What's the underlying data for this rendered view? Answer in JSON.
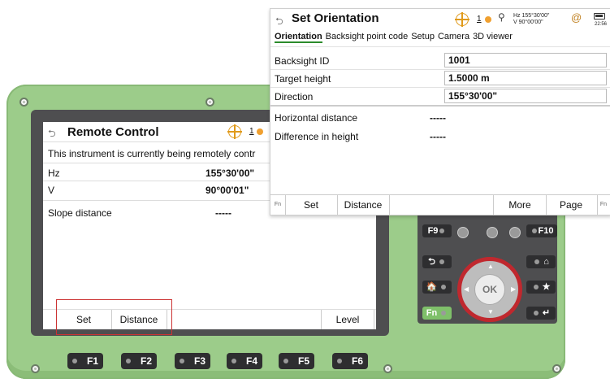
{
  "remote_control": {
    "title": "Remote Control",
    "prism_number": "1",
    "info": "This instrument is currently being remotely contr",
    "rows": [
      {
        "label": "Hz",
        "value": "155°30'00\""
      },
      {
        "label": "V",
        "value": "90°00'01\""
      },
      {
        "label": "Slope distance",
        "value": "-----"
      }
    ],
    "softkeys": [
      "Set",
      "Distance",
      "Level"
    ]
  },
  "function_keys": [
    "F1",
    "F2",
    "F3",
    "F4",
    "F5",
    "F6"
  ],
  "keypad": {
    "f9": "F9",
    "f10": "F10",
    "fn": "Fn",
    "ok": "OK"
  },
  "set_orientation": {
    "title": "Set Orientation",
    "prism_number": "1",
    "status": {
      "hz": "Hz 155°30'00\"",
      "v": "V   90°00'00\"",
      "time": "22:56"
    },
    "tabs": [
      "Orientation",
      "Backsight point code",
      "Setup",
      "Camera",
      "3D viewer"
    ],
    "fields": [
      {
        "label": "Backsight ID",
        "value": "1001"
      },
      {
        "label": "Target height",
        "value": "1.5000 m"
      },
      {
        "label": "Direction",
        "value": "155°30'00\""
      }
    ],
    "readonly": [
      {
        "label": "Horizontal distance",
        "value": "-----"
      },
      {
        "label": "Difference in height",
        "value": "-----"
      }
    ],
    "softkeys": {
      "fn_left": "Fn",
      "set": "Set",
      "distance": "Distance",
      "more": "More",
      "page": "Page",
      "fn_right": "Fn"
    }
  },
  "colors": {
    "device_green": "#9ccc8a",
    "accent_red": "#c0282e",
    "target_orange": "#e09a1a",
    "tab_underline": "#2b8b2b"
  }
}
